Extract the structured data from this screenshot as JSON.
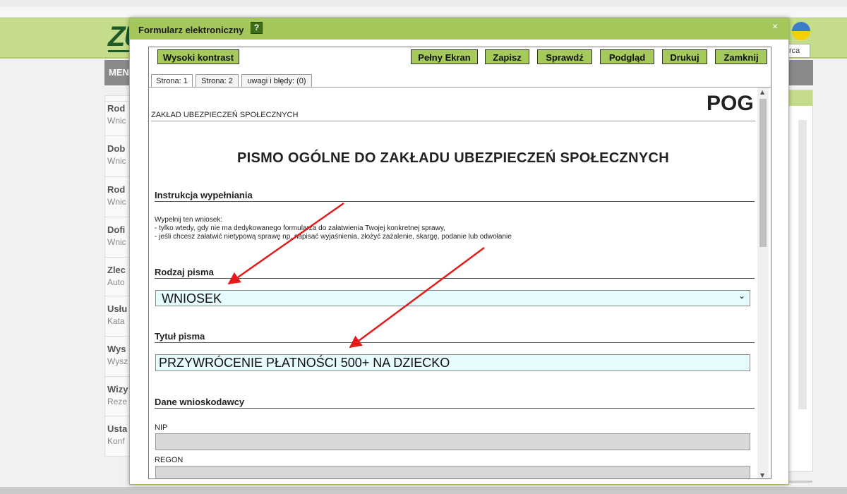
{
  "background": {
    "logo": "ZU",
    "menu_label": "MENU",
    "search_value": "rca",
    "sidebar_items": [
      {
        "title": "Rod",
        "subtitle": "Wnic"
      },
      {
        "title": "Dob",
        "subtitle": "Wnic"
      },
      {
        "title": "Rod",
        "subtitle": "Wnic"
      },
      {
        "title": "Dofi",
        "subtitle": "Wnic"
      },
      {
        "title": "Zlec",
        "subtitle": "Auto"
      },
      {
        "title": "Usłu",
        "subtitle": "Kata"
      },
      {
        "title": "Wys",
        "subtitle": "Wysz"
      },
      {
        "title": "Wizy",
        "subtitle": "Reze"
      },
      {
        "title": "Usta",
        "subtitle": "Konf"
      }
    ]
  },
  "modal": {
    "title": "Formularz elektroniczny",
    "help_glyph": "?",
    "close_glyph": "×",
    "toolbar": {
      "high_contrast": "Wysoki kontrast",
      "full_screen": "Pełny Ekran",
      "save": "Zapisz",
      "check": "Sprawdź",
      "preview": "Podgląd",
      "print": "Drukuj",
      "close": "Zamknij"
    },
    "tabs": [
      "Strona: 1",
      "Strona: 2",
      "uwagi i błędy: (0)"
    ]
  },
  "form": {
    "organization": "ZAKŁAD UBEZPIECZEŃ SPOŁECZNYCH",
    "form_code": "POG",
    "main_title": "PISMO OGÓLNE DO ZAKŁADU UBEZPIECZEŃ SPOŁECZNYCH",
    "instructions_heading": "Instrukcja wypełniania",
    "instructions": [
      "Wypełnij ten wniosek:",
      "- tylko wtedy, gdy nie ma dedykowanego formularza do załatwienia Twojej konkretnej sprawy,",
      "- jeśli chcesz załatwić nietypową sprawę np. napisać wyjaśnienia, złożyć zażalenie, skargę, podanie lub odwołanie"
    ],
    "letter_type_heading": "Rodzaj pisma",
    "letter_type_value": "WNIOSEK",
    "letter_title_heading": "Tytuł pisma",
    "letter_title_value": "PRZYWRÓCENIE PŁATNOŚCI 500+ NA DZIECKO",
    "applicant_heading": "Dane wnioskodawcy",
    "nip_label": "NIP",
    "nip_value": "",
    "regon_label": "REGON",
    "regon_value": ""
  },
  "colors": {
    "header_green": "#c5dd8a",
    "modal_green": "#a3c75a",
    "button_green": "#a6c95b",
    "input_cyan": "#e5fbfd",
    "input_grey": "#d8d8d8",
    "annotation_red": "#e41b1b"
  }
}
